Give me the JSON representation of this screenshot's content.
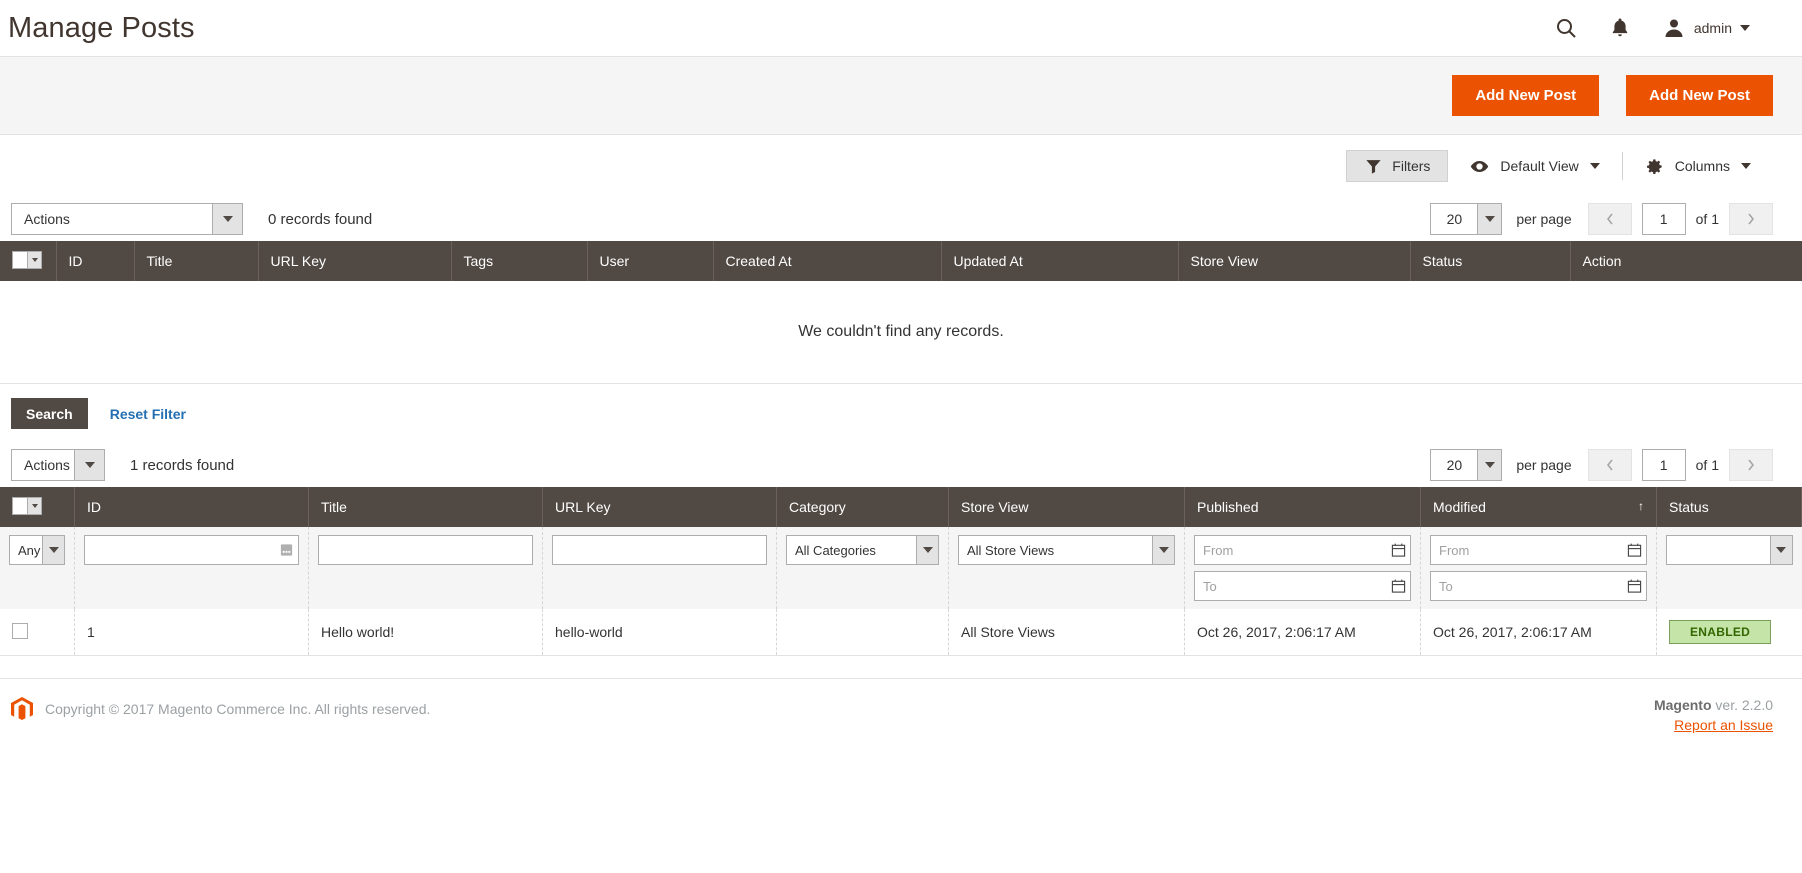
{
  "header": {
    "title": "Manage Posts",
    "search_icon": "search-icon",
    "notifications_icon": "bell-icon",
    "user_icon": "user-avatar-icon",
    "admin_label": "admin"
  },
  "action_bar": {
    "buttons": [
      {
        "label": "Add New Post"
      },
      {
        "label": "Add New Post"
      }
    ],
    "accent_color": "#eb5202"
  },
  "grid_toolbar": {
    "filters_label": "Filters",
    "filters_icon": "funnel-icon",
    "view_icon": "eye-icon",
    "view_label": "Default View",
    "columns_icon": "gear-icon",
    "columns_label": "Columns"
  },
  "grid_top": {
    "actions_label": "Actions",
    "records_found": "0 records found",
    "per_page_value": "20",
    "per_page_label": "per page",
    "page_value": "1",
    "page_total": "of 1",
    "prev_icon": "chevron-left-icon",
    "next_icon": "chevron-right-icon",
    "columns": [
      "ID",
      "Title",
      "URL Key",
      "Tags",
      "User",
      "Created At",
      "Updated At",
      "Store View",
      "Status",
      "Action"
    ],
    "empty_message": "We couldn't find any records."
  },
  "search_row": {
    "search_label": "Search",
    "reset_label": "Reset Filter"
  },
  "grid_bottom": {
    "actions_label": "Actions",
    "records_found": "1 records found",
    "per_page_value": "20",
    "per_page_label": "per page",
    "page_value": "1",
    "page_total": "of 1",
    "columns": [
      {
        "label": "ID",
        "sort": ""
      },
      {
        "label": "Title",
        "sort": ""
      },
      {
        "label": "URL Key",
        "sort": ""
      },
      {
        "label": "Category",
        "sort": ""
      },
      {
        "label": "Store View",
        "sort": ""
      },
      {
        "label": "Published",
        "sort": ""
      },
      {
        "label": "Modified",
        "sort": "↑"
      },
      {
        "label": "Status",
        "sort": ""
      }
    ],
    "filters": {
      "any_label": "Any",
      "id_value": "",
      "title_value": "",
      "url_key_value": "",
      "category_value": "All Categories",
      "store_view_value": "All Store Views",
      "published_from": "From",
      "published_to": "To",
      "modified_from": "From",
      "modified_to": "To",
      "status_value": "",
      "calendar_icon": "calendar-icon",
      "range_icon": "range-icon"
    },
    "rows": [
      {
        "id": "1",
        "title": "Hello world!",
        "url_key": "hello-world",
        "category": "",
        "store_view": "All Store Views",
        "published": "Oct 26, 2017, 2:06:17 AM",
        "modified": "Oct 26, 2017, 2:06:17 AM",
        "status": "ENABLED"
      }
    ]
  },
  "footer": {
    "logo_icon": "magento-logo-icon",
    "copyright": "Copyright © 2017 Magento Commerce Inc. All rights reserved.",
    "version_brand": "Magento",
    "version_text": " ver. 2.2.0",
    "report_link": "Report an Issue"
  }
}
